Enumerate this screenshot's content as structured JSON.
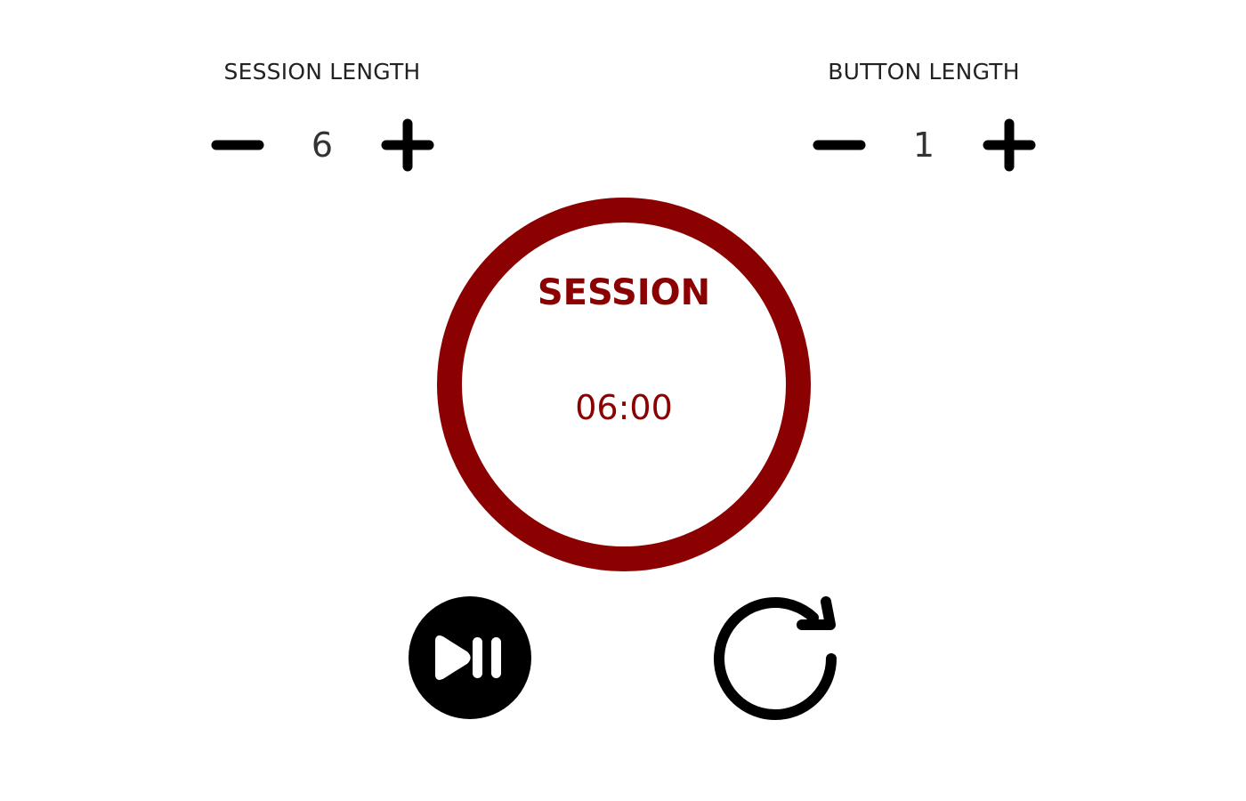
{
  "session": {
    "label": "SESSION LENGTH",
    "value": "6",
    "decrement_icon": "minus-icon",
    "increment_icon": "plus-icon"
  },
  "button": {
    "label": "BUTTON LENGTH",
    "value": "1",
    "decrement_icon": "minus-icon",
    "increment_icon": "plus-icon"
  },
  "timer": {
    "title": "SESSION",
    "time": "06:00",
    "ring_color": "#8b0000",
    "text_color": "#8b0000"
  },
  "controls": {
    "play_pause_icon": "play-pause-icon",
    "reset_icon": "reset-icon"
  }
}
